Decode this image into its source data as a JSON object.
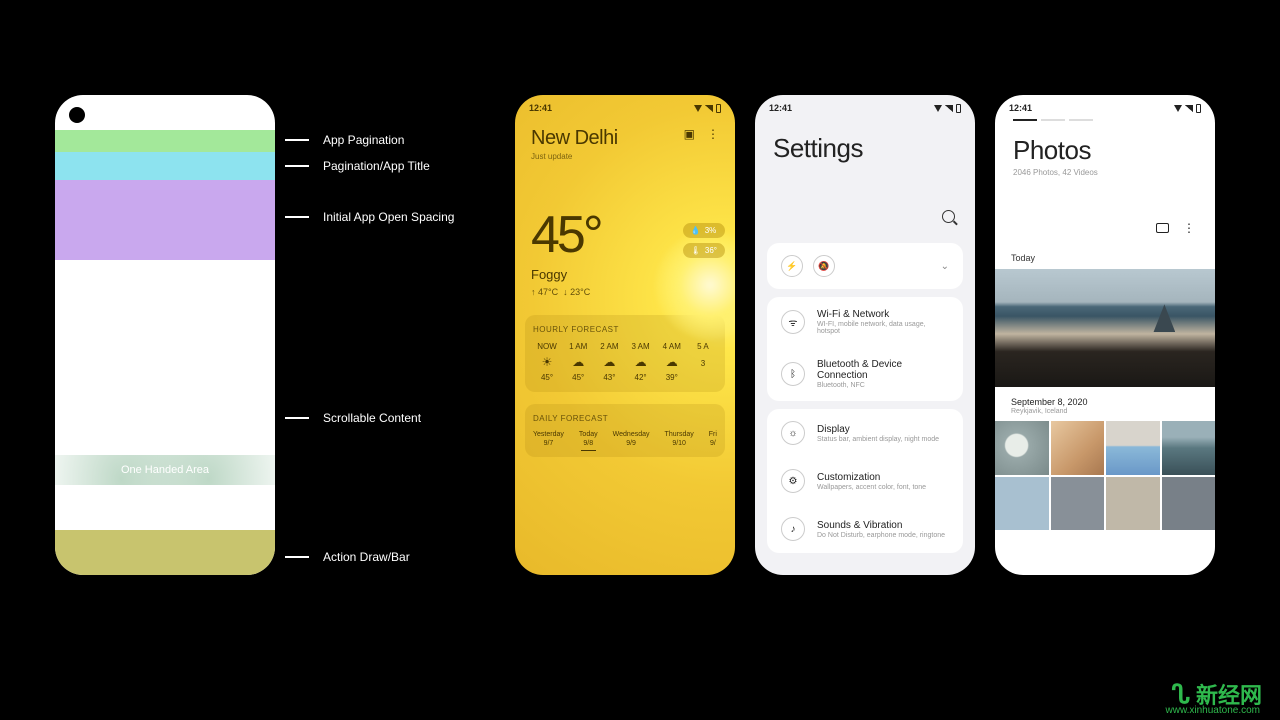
{
  "diagram": {
    "one_handed_label": "One Handed Area",
    "labels": [
      "App Pagination",
      "Pagination/App Title",
      "Initial App Open Spacing",
      "Scrollable Content",
      "Action Draw/Bar"
    ]
  },
  "weather": {
    "time": "12:41",
    "city": "New Delhi",
    "updated": "Just update",
    "temp": "45°",
    "condition": "Foggy",
    "high": "↑ 47°C",
    "low": "↓ 23°C",
    "pill1": "3%",
    "pill2": "36°",
    "hourly_title": "HOURLY FORECAST",
    "hourly": [
      {
        "t": "NOW",
        "icon": "☀",
        "temp": "45°"
      },
      {
        "t": "1 AM",
        "icon": "☁",
        "temp": "45°"
      },
      {
        "t": "2 AM",
        "icon": "☁",
        "temp": "43°"
      },
      {
        "t": "3 AM",
        "icon": "☁",
        "temp": "42°"
      },
      {
        "t": "4 AM",
        "icon": "☁",
        "temp": "39°"
      },
      {
        "t": "5 A",
        "icon": "",
        "temp": "3"
      }
    ],
    "daily_title": "DAILY FORECAST",
    "daily": [
      {
        "d": "Yesterday",
        "dt": "9/7"
      },
      {
        "d": "Today",
        "dt": "9/8"
      },
      {
        "d": "Wednesday",
        "dt": "9/9"
      },
      {
        "d": "Thursday",
        "dt": "9/10"
      },
      {
        "d": "Fri",
        "dt": "9/"
      }
    ]
  },
  "settings": {
    "time": "12:41",
    "title": "Settings",
    "items": [
      {
        "icon": "ᯤ",
        "title": "Wi-Fi & Network",
        "sub": "WI-FI, mobile network, data usage, hotspot"
      },
      {
        "icon": "ᛒ",
        "title": "Bluetooth & Device Connection",
        "sub": "Bluetooth, NFC"
      },
      {
        "icon": "☼",
        "title": "Display",
        "sub": "Status bar, ambient display, night mode"
      },
      {
        "icon": "⚙",
        "title": "Customization",
        "sub": "Wallpapers, accent color, font, tone"
      },
      {
        "icon": "♪",
        "title": "Sounds & Vibration",
        "sub": "Do Not Disturb, earphone mode, ringtone"
      }
    ]
  },
  "photos": {
    "time": "12:41",
    "title": "Photos",
    "subtitle": "2046 Photos, 42 Videos",
    "section_today": "Today",
    "album_title": "September 8, 2020",
    "album_sub": "Reykjavik, Iceland"
  },
  "watermark": {
    "cn": "新经网",
    "url": "www.xinhuatone.com"
  }
}
